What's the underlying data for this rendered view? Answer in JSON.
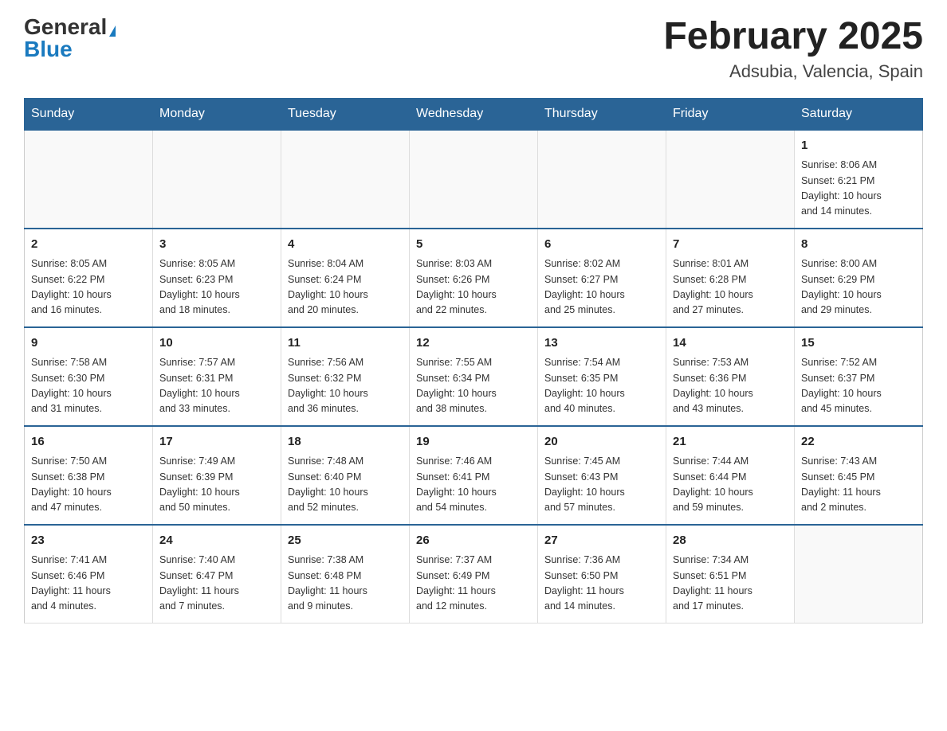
{
  "header": {
    "logo": {
      "general": "General",
      "blue": "Blue"
    },
    "title": "February 2025",
    "location": "Adsubia, Valencia, Spain"
  },
  "days_of_week": [
    "Sunday",
    "Monday",
    "Tuesday",
    "Wednesday",
    "Thursday",
    "Friday",
    "Saturday"
  ],
  "weeks": [
    [
      {
        "day": "",
        "info": ""
      },
      {
        "day": "",
        "info": ""
      },
      {
        "day": "",
        "info": ""
      },
      {
        "day": "",
        "info": ""
      },
      {
        "day": "",
        "info": ""
      },
      {
        "day": "",
        "info": ""
      },
      {
        "day": "1",
        "info": "Sunrise: 8:06 AM\nSunset: 6:21 PM\nDaylight: 10 hours\nand 14 minutes."
      }
    ],
    [
      {
        "day": "2",
        "info": "Sunrise: 8:05 AM\nSunset: 6:22 PM\nDaylight: 10 hours\nand 16 minutes."
      },
      {
        "day": "3",
        "info": "Sunrise: 8:05 AM\nSunset: 6:23 PM\nDaylight: 10 hours\nand 18 minutes."
      },
      {
        "day": "4",
        "info": "Sunrise: 8:04 AM\nSunset: 6:24 PM\nDaylight: 10 hours\nand 20 minutes."
      },
      {
        "day": "5",
        "info": "Sunrise: 8:03 AM\nSunset: 6:26 PM\nDaylight: 10 hours\nand 22 minutes."
      },
      {
        "day": "6",
        "info": "Sunrise: 8:02 AM\nSunset: 6:27 PM\nDaylight: 10 hours\nand 25 minutes."
      },
      {
        "day": "7",
        "info": "Sunrise: 8:01 AM\nSunset: 6:28 PM\nDaylight: 10 hours\nand 27 minutes."
      },
      {
        "day": "8",
        "info": "Sunrise: 8:00 AM\nSunset: 6:29 PM\nDaylight: 10 hours\nand 29 minutes."
      }
    ],
    [
      {
        "day": "9",
        "info": "Sunrise: 7:58 AM\nSunset: 6:30 PM\nDaylight: 10 hours\nand 31 minutes."
      },
      {
        "day": "10",
        "info": "Sunrise: 7:57 AM\nSunset: 6:31 PM\nDaylight: 10 hours\nand 33 minutes."
      },
      {
        "day": "11",
        "info": "Sunrise: 7:56 AM\nSunset: 6:32 PM\nDaylight: 10 hours\nand 36 minutes."
      },
      {
        "day": "12",
        "info": "Sunrise: 7:55 AM\nSunset: 6:34 PM\nDaylight: 10 hours\nand 38 minutes."
      },
      {
        "day": "13",
        "info": "Sunrise: 7:54 AM\nSunset: 6:35 PM\nDaylight: 10 hours\nand 40 minutes."
      },
      {
        "day": "14",
        "info": "Sunrise: 7:53 AM\nSunset: 6:36 PM\nDaylight: 10 hours\nand 43 minutes."
      },
      {
        "day": "15",
        "info": "Sunrise: 7:52 AM\nSunset: 6:37 PM\nDaylight: 10 hours\nand 45 minutes."
      }
    ],
    [
      {
        "day": "16",
        "info": "Sunrise: 7:50 AM\nSunset: 6:38 PM\nDaylight: 10 hours\nand 47 minutes."
      },
      {
        "day": "17",
        "info": "Sunrise: 7:49 AM\nSunset: 6:39 PM\nDaylight: 10 hours\nand 50 minutes."
      },
      {
        "day": "18",
        "info": "Sunrise: 7:48 AM\nSunset: 6:40 PM\nDaylight: 10 hours\nand 52 minutes."
      },
      {
        "day": "19",
        "info": "Sunrise: 7:46 AM\nSunset: 6:41 PM\nDaylight: 10 hours\nand 54 minutes."
      },
      {
        "day": "20",
        "info": "Sunrise: 7:45 AM\nSunset: 6:43 PM\nDaylight: 10 hours\nand 57 minutes."
      },
      {
        "day": "21",
        "info": "Sunrise: 7:44 AM\nSunset: 6:44 PM\nDaylight: 10 hours\nand 59 minutes."
      },
      {
        "day": "22",
        "info": "Sunrise: 7:43 AM\nSunset: 6:45 PM\nDaylight: 11 hours\nand 2 minutes."
      }
    ],
    [
      {
        "day": "23",
        "info": "Sunrise: 7:41 AM\nSunset: 6:46 PM\nDaylight: 11 hours\nand 4 minutes."
      },
      {
        "day": "24",
        "info": "Sunrise: 7:40 AM\nSunset: 6:47 PM\nDaylight: 11 hours\nand 7 minutes."
      },
      {
        "day": "25",
        "info": "Sunrise: 7:38 AM\nSunset: 6:48 PM\nDaylight: 11 hours\nand 9 minutes."
      },
      {
        "day": "26",
        "info": "Sunrise: 7:37 AM\nSunset: 6:49 PM\nDaylight: 11 hours\nand 12 minutes."
      },
      {
        "day": "27",
        "info": "Sunrise: 7:36 AM\nSunset: 6:50 PM\nDaylight: 11 hours\nand 14 minutes."
      },
      {
        "day": "28",
        "info": "Sunrise: 7:34 AM\nSunset: 6:51 PM\nDaylight: 11 hours\nand 17 minutes."
      },
      {
        "day": "",
        "info": ""
      }
    ]
  ]
}
